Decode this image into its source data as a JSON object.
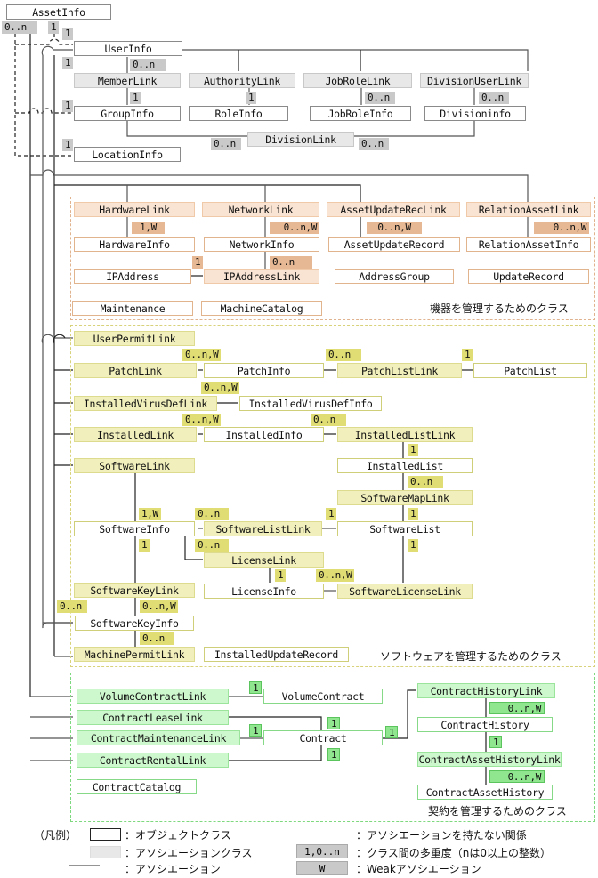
{
  "colors": {
    "association_line": "#555555",
    "group_hardware": "#e0b38e",
    "group_software": "#d8d27a",
    "group_contract": "#7ed97e"
  },
  "root": {
    "asset_info": "AssetInfo",
    "mult_left": "0..n",
    "mult_right": "1"
  },
  "user_section": {
    "user_info": "UserInfo",
    "user_mult": "1",
    "user_mult_below": "1",
    "member_link": "MemberLink",
    "member_link_mult_top": "0..n",
    "member_link_mult_bottom": "1",
    "authority_link": "AuthorityLink",
    "authority_link_mult": "1",
    "job_role_link": "JobRoleLink",
    "job_role_link_mult": "0..n",
    "division_user_link": "DivisionUserLink",
    "division_user_link_mult": "0..n",
    "group_info": "GroupInfo",
    "group_info_mult": "1",
    "role_info": "RoleInfo",
    "job_role_info": "JobRoleInfo",
    "division_info": "Divisioninfo",
    "division_link": "DivisionLink",
    "division_link_mult_left": "0..n",
    "division_link_mult_right": "0..n",
    "location_info": "LocationInfo",
    "location_info_mult": "1"
  },
  "hardware_group": {
    "label": "機器を管理するためのクラス",
    "hardware_link": "HardwareLink",
    "hardware_link_mult": "1,W",
    "network_link": "NetworkLink",
    "network_link_mult": "0..n,W",
    "asset_update_rec_link": "AssetUpdateRecLink",
    "asset_update_rec_link_mult": "0..n,W",
    "relation_asset_link": "RelationAssetLink",
    "relation_asset_link_mult": "0..n,W",
    "hardware_info": "HardwareInfo",
    "network_info": "NetworkInfo",
    "network_info_mult": "0..n",
    "asset_update_record": "AssetUpdateRecord",
    "relation_asset_info": "RelationAssetInfo",
    "ip_address": "IPAddress",
    "ip_address_mult": "1",
    "ip_address_link": "IPAddressLink",
    "address_group": "AddressGroup",
    "update_record": "UpdateRecord",
    "maintenance": "Maintenance",
    "machine_catalog": "MachineCatalog"
  },
  "software_group": {
    "label": "ソフトウェアを管理するためのクラス",
    "user_permit_link": "UserPermitLink",
    "patch_link_mult": "0..n,W",
    "patch_link": "PatchLink",
    "patch_info": "PatchInfo",
    "patch_list_link_mult": "0..n",
    "patch_list_link": "PatchListLink",
    "patch_list_mult": "1",
    "patch_list": "PatchList",
    "installed_virus_def_link_mult": "0..n,W",
    "installed_virus_def_link": "InstalledVirusDefLink",
    "installed_virus_def_info": "InstalledVirusDefInfo",
    "installed_link_mult": "0..n,W",
    "installed_link": "InstalledLink",
    "installed_info": "InstalledInfo",
    "installed_list_link_mult": "0..n",
    "installed_list_link": "InstalledListLink",
    "installed_list_mult": "1",
    "installed_list": "InstalledList",
    "software_map_link_mult": "0..n",
    "software_map_link": "SoftwareMapLink",
    "software_list_mult_top": "1",
    "software_link": "SoftwareLink",
    "software_info_mult_top": "1,W",
    "software_info": "SoftwareInfo",
    "software_info_mult_bottom": "1",
    "software_list_link_mult": "0..n",
    "software_list_link": "SoftwareListLink",
    "software_list_link_mult_right": "1",
    "software_list": "SoftwareList",
    "software_list_mult_bottom": "1",
    "license_link_mult": "0..n",
    "license_link": "LicenseLink",
    "license_info_mult": "1",
    "license_info": "LicenseInfo",
    "software_license_link_mult": "0..n,W",
    "software_license_link": "SoftwareLicenseLink",
    "software_key_link": "SoftwareKeyLink",
    "software_key_info_mult_left": "0..n",
    "software_key_info_mult": "0..n,W",
    "software_key_info": "SoftwareKeyInfo",
    "machine_permit_link_mult": "0..n",
    "machine_permit_link": "MachinePermitLink",
    "installed_update_record": "InstalledUpdateRecord"
  },
  "contract_group": {
    "label": "契約を管理するためのクラス",
    "volume_contract_link": "VolumeContractLink",
    "volume_contract_mult": "1",
    "volume_contract": "VolumeContract",
    "contract_lease_link": "ContractLeaseLink",
    "contract_maintenance_link": "ContractMaintenanceLink",
    "contract_rental_link": "ContractRentalLink",
    "contract_mult_top": "1",
    "contract_mult_left": "1",
    "contract_mult_bottom": "1",
    "contract": "Contract",
    "contract_mult_right": "1",
    "contract_catalog": "ContractCatalog",
    "contract_history_link": "ContractHistoryLink",
    "contract_history_mult": "0..n,W",
    "contract_history": "ContractHistory",
    "contract_asset_history_link_mult": "1",
    "contract_asset_history_link": "ContractAssetHistoryLink",
    "contract_asset_history_mult": "0..n,W",
    "contract_asset_history": "ContractAssetHistory"
  },
  "legend": {
    "title": "（凡例）",
    "object_class": "：オブジェクトクラス",
    "association_class": "：アソシエーションクラス",
    "association": "：アソシエーション",
    "dashed_sample": "------",
    "no_association": "：アソシエーションを持たない関係",
    "mult_sample": "1,0..n",
    "multiplicity": "：クラス間の多重度（nは0以上の整数）",
    "weak_sample": "W",
    "weak": "：Weakアソシエーション"
  }
}
